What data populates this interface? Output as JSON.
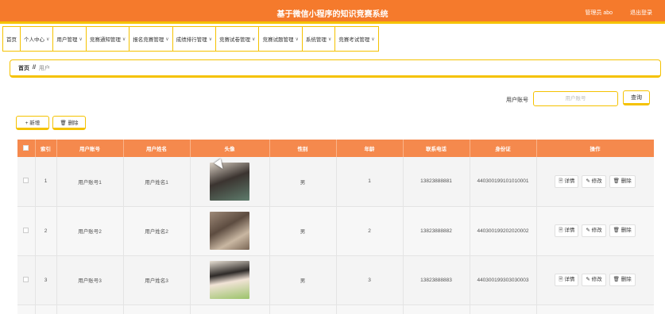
{
  "header": {
    "title": "基于微信小程序的知识竞赛系统",
    "admin_text": "管理员 abo",
    "logout": "退出登录"
  },
  "nav": {
    "items": [
      {
        "label": "首页",
        "has_dropdown": false
      },
      {
        "label": "个人中心",
        "has_dropdown": true
      },
      {
        "label": "用户管理",
        "has_dropdown": true
      },
      {
        "label": "竞赛通知管理",
        "has_dropdown": true
      },
      {
        "label": "报名竞赛管理",
        "has_dropdown": true
      },
      {
        "label": "成绩排行管理",
        "has_dropdown": true
      },
      {
        "label": "竞赛试卷管理",
        "has_dropdown": true
      },
      {
        "label": "竞赛试题管理",
        "has_dropdown": true
      },
      {
        "label": "系统管理",
        "has_dropdown": true
      },
      {
        "label": "竞赛考试管理",
        "has_dropdown": true
      }
    ]
  },
  "breadcrumb": {
    "home": "首页",
    "separator": "//",
    "current": "用户"
  },
  "search": {
    "label": "用户账号",
    "placeholder": "用户账号",
    "button": "查询"
  },
  "toolbar": {
    "add": "+ 新增",
    "delete": "删除"
  },
  "table": {
    "columns": [
      "索引",
      "用户账号",
      "用户姓名",
      "头像",
      "性别",
      "年龄",
      "联系电话",
      "身份证",
      "操作"
    ],
    "rows": [
      {
        "index": "1",
        "account": "用户账号1",
        "name": "用户姓名1",
        "gender": "男",
        "age": "1",
        "phone": "13823888881",
        "id_card": "440300199101010001"
      },
      {
        "index": "2",
        "account": "用户账号2",
        "name": "用户姓名2",
        "gender": "男",
        "age": "2",
        "phone": "13823888882",
        "id_card": "440300199202020002"
      },
      {
        "index": "3",
        "account": "用户账号3",
        "name": "用户姓名3",
        "gender": "男",
        "age": "3",
        "phone": "13823888883",
        "id_card": "440300199303030003"
      }
    ],
    "actions": {
      "detail": "详情",
      "edit": "修改",
      "delete": "删除"
    }
  },
  "colors": {
    "primary": "#f57a2c",
    "accent": "#f5c200",
    "header_row": "#f5894d"
  },
  "icons": [
    "checkbox",
    "file-icon",
    "edit-icon",
    "trash-icon",
    "chevron-down-icon",
    "mouse-cursor"
  ]
}
